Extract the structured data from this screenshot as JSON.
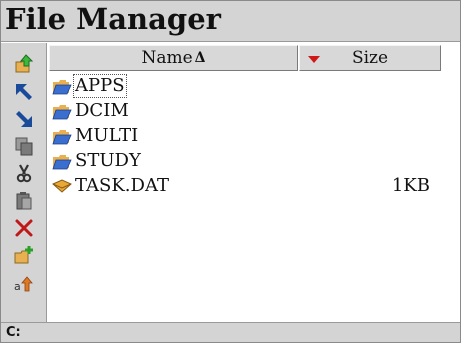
{
  "window": {
    "title": "File Manager"
  },
  "toolbar": {
    "buttons": [
      {
        "name": "up-folder-button",
        "icon": "folder-up-icon"
      },
      {
        "name": "scroll-top-button",
        "icon": "arrow-up-left-icon"
      },
      {
        "name": "scroll-bottom-button",
        "icon": "arrow-down-right-icon"
      },
      {
        "name": "copy-button",
        "icon": "copy-icon"
      },
      {
        "name": "cut-button",
        "icon": "scissors-icon"
      },
      {
        "name": "paste-button",
        "icon": "paste-icon"
      },
      {
        "name": "delete-button",
        "icon": "delete-x-icon"
      },
      {
        "name": "new-folder-button",
        "icon": "new-folder-icon"
      },
      {
        "name": "rename-button",
        "icon": "rename-icon"
      }
    ]
  },
  "columns": {
    "name_label": "Name",
    "name_sort_indicator": "Δ",
    "size_label": "Size"
  },
  "files": [
    {
      "name": "APPS",
      "type": "folder",
      "size": "",
      "selected": true
    },
    {
      "name": "DCIM",
      "type": "folder",
      "size": "",
      "selected": false
    },
    {
      "name": "MULTI",
      "type": "folder",
      "size": "",
      "selected": false
    },
    {
      "name": "STUDY",
      "type": "folder",
      "size": "",
      "selected": false
    },
    {
      "name": "TASK.DAT",
      "type": "file",
      "size": "1KB",
      "selected": false
    }
  ],
  "status": {
    "path": "C:"
  },
  "colors": {
    "chrome": "#d4d4d4",
    "folder": "#3a6fd0",
    "folder_tab": "#e8b050",
    "accent_red": "#d01818"
  }
}
